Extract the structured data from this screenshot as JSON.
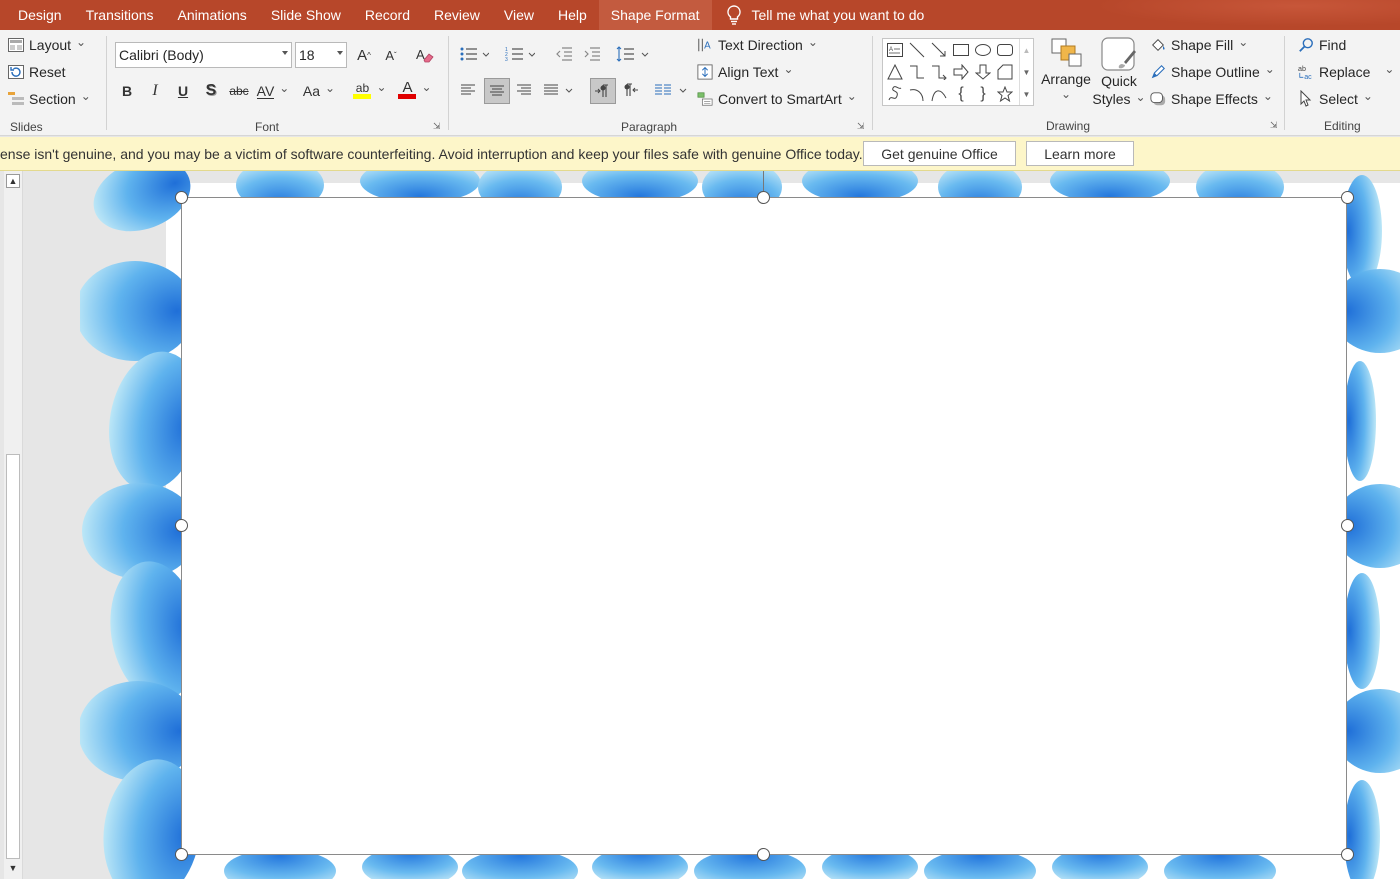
{
  "tabs": {
    "items": [
      "Design",
      "Transitions",
      "Animations",
      "Slide Show",
      "Record",
      "Review",
      "View",
      "Help",
      "Shape Format"
    ],
    "active": "Shape Format",
    "tell_me": "Tell me what you want to do"
  },
  "ribbon": {
    "slides": {
      "layout": "Layout",
      "reset": "Reset",
      "section": "Section",
      "label": "Slides"
    },
    "font": {
      "name": "Calibri (Body)",
      "size": "18",
      "grow": "A",
      "shrink": "A",
      "bold": "B",
      "italic": "I",
      "underline": "U",
      "shadow": "S",
      "strike": "abc",
      "spacing": "AV",
      "change_case": "Aa",
      "highlight": "ab",
      "font_color": "A",
      "label": "Font"
    },
    "paragraph": {
      "text_direction": "Text Direction",
      "align_text": "Align Text",
      "convert_smartart": "Convert to SmartArt",
      "label": "Paragraph"
    },
    "drawing": {
      "arrange": "Arrange",
      "quick_styles_1": "Quick",
      "quick_styles_2": "Styles",
      "shape_fill": "Shape Fill",
      "shape_outline": "Shape Outline",
      "shape_effects": "Shape Effects",
      "label": "Drawing"
    },
    "editing": {
      "find": "Find",
      "replace": "Replace",
      "select": "Select",
      "label": "Editing"
    }
  },
  "infobar": {
    "message": "ense isn't genuine, and you may be a victim of software counterfeiting. Avoid interruption and keep your files safe with genuine Office today.",
    "get_genuine": "Get genuine Office",
    "learn_more": "Learn more"
  },
  "colors": {
    "accent": "#b7472a",
    "infobar": "#fdf6c9",
    "highlight_yellow": "#ffff00",
    "font_red": "#e00000",
    "petal_blue": "#3a8ee6"
  }
}
